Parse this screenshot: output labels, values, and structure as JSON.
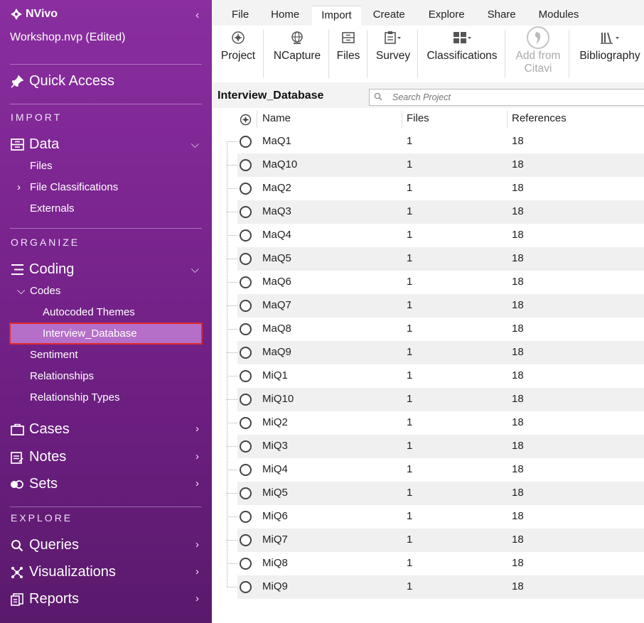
{
  "sidebar": {
    "app_name": "NVivo",
    "project_name": "Workshop.nvp (Edited)",
    "quick_access": "Quick Access",
    "import_header": "IMPORT",
    "data_label": "Data",
    "data_items": [
      "Files",
      "File Classifications",
      "Externals"
    ],
    "organize_header": "ORGANIZE",
    "coding_label": "Coding",
    "codes_label": "Codes",
    "codes_items": [
      "Autocoded Themes",
      "Interview_Database"
    ],
    "coding_items": [
      "Sentiment",
      "Relationships",
      "Relationship Types"
    ],
    "cases_label": "Cases",
    "notes_label": "Notes",
    "sets_label": "Sets",
    "explore_header": "EXPLORE",
    "queries_label": "Queries",
    "visualizations_label": "Visualizations",
    "reports_label": "Reports"
  },
  "ribbon": {
    "tabs": [
      "File",
      "Home",
      "Import",
      "Create",
      "Explore",
      "Share",
      "Modules"
    ],
    "active_tab": "Import",
    "tools": [
      {
        "label": "Project",
        "icon": "project-import-icon"
      },
      {
        "label": "NCapture",
        "icon": "globe-icon"
      },
      {
        "label": "Files",
        "icon": "files-icon"
      },
      {
        "label": "Survey",
        "icon": "clipboard-icon"
      },
      {
        "label": "Classifications",
        "icon": "grid-icon"
      },
      {
        "label": "Add from",
        "label2": "Citavi",
        "icon": "citavi-icon",
        "disabled": true
      },
      {
        "label": "Bibliography",
        "icon": "library-icon"
      }
    ]
  },
  "list": {
    "title": "Interview_Database",
    "search_placeholder": "Search Project",
    "columns": [
      "Name",
      "Files",
      "References"
    ],
    "rows": [
      {
        "name": "MaQ1",
        "files": "1",
        "refs": "18"
      },
      {
        "name": "MaQ10",
        "files": "1",
        "refs": "18"
      },
      {
        "name": "MaQ2",
        "files": "1",
        "refs": "18"
      },
      {
        "name": "MaQ3",
        "files": "1",
        "refs": "18"
      },
      {
        "name": "MaQ4",
        "files": "1",
        "refs": "18"
      },
      {
        "name": "MaQ5",
        "files": "1",
        "refs": "18"
      },
      {
        "name": "MaQ6",
        "files": "1",
        "refs": "18"
      },
      {
        "name": "MaQ7",
        "files": "1",
        "refs": "18"
      },
      {
        "name": "MaQ8",
        "files": "1",
        "refs": "18"
      },
      {
        "name": "MaQ9",
        "files": "1",
        "refs": "18"
      },
      {
        "name": "MiQ1",
        "files": "1",
        "refs": "18"
      },
      {
        "name": "MiQ10",
        "files": "1",
        "refs": "18"
      },
      {
        "name": "MiQ2",
        "files": "1",
        "refs": "18"
      },
      {
        "name": "MiQ3",
        "files": "1",
        "refs": "18"
      },
      {
        "name": "MiQ4",
        "files": "1",
        "refs": "18"
      },
      {
        "name": "MiQ5",
        "files": "1",
        "refs": "18"
      },
      {
        "name": "MiQ6",
        "files": "1",
        "refs": "18"
      },
      {
        "name": "MiQ7",
        "files": "1",
        "refs": "18"
      },
      {
        "name": "MiQ8",
        "files": "1",
        "refs": "18"
      },
      {
        "name": "MiQ9",
        "files": "1",
        "refs": "18"
      }
    ]
  },
  "colors": {
    "sidebar": "#7b2590",
    "selected_item": "#b56fc8",
    "selection_outline": "#e0282c"
  }
}
